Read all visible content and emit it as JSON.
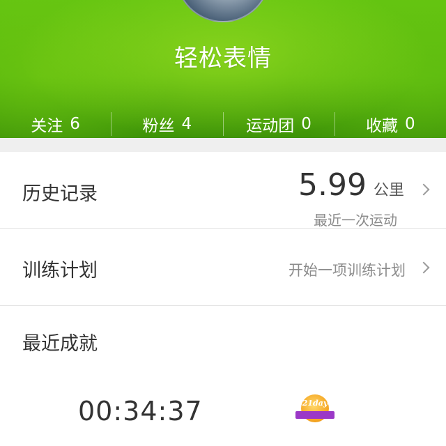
{
  "profile": {
    "name": "轻松表情"
  },
  "stats": [
    {
      "label": "关注",
      "value": "6"
    },
    {
      "label": "粉丝",
      "value": "4"
    },
    {
      "label": "运动团",
      "value": "0"
    },
    {
      "label": "收藏",
      "value": "0"
    }
  ],
  "history": {
    "label": "历史记录",
    "distance": "5.99",
    "unit": "公里",
    "subtitle": "最近一次运动"
  },
  "training": {
    "label": "训练计划",
    "hint": "开始一项训练计划"
  },
  "achievements": {
    "label": "最近成就",
    "time": "00:34:37",
    "badge_text": "21day"
  },
  "colors": {
    "header_green": "#5cbd0f",
    "text_primary": "#333333",
    "text_secondary": "#8c8c8c",
    "badge_gold": "#f5a623",
    "badge_purple": "#9b38c7"
  },
  "icons": [
    "avatar",
    "chevron-right-icon",
    "achievement-badge-icon"
  ]
}
